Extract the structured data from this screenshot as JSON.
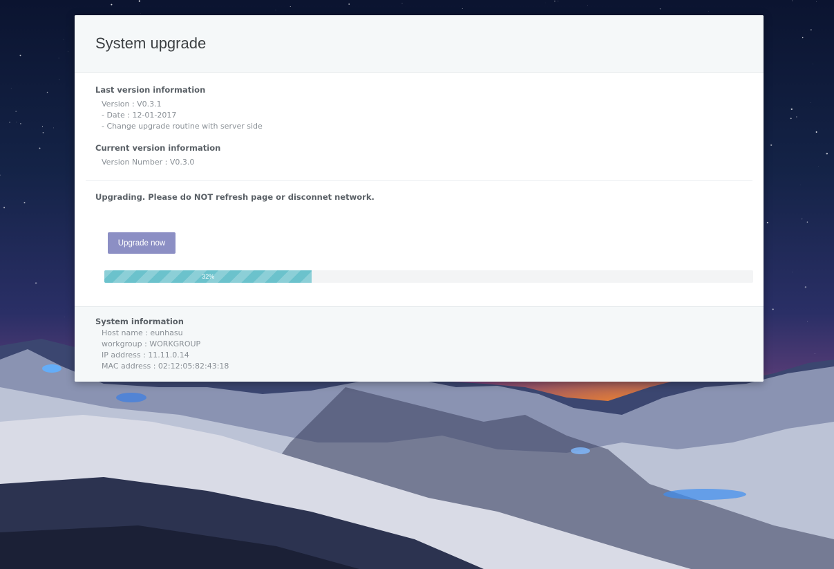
{
  "title": "System upgrade",
  "last_version": {
    "heading": "Last version information",
    "lines": [
      "Version : V0.3.1",
      "- Date : 12-01-2017",
      "- Change upgrade routine with server side"
    ]
  },
  "current_version": {
    "heading": "Current version information",
    "line": "Version Number : V0.3.0"
  },
  "warning": "Upgrading. Please do NOT refresh page or disconnet network.",
  "upgrade_button": "Upgrade now",
  "progress": {
    "percent": 32,
    "label": "32%"
  },
  "system_info": {
    "heading": "System information",
    "lines": [
      "Host name : eunhasu",
      "workgroup : WORKGROUP",
      "IP address : 11.11.0.14",
      "MAC address : 02:12:05:82:43:18"
    ]
  },
  "colors": {
    "button": "#8c8fc4",
    "progress_fill": "#6bc2cc",
    "header_bg": "#f5f8f9"
  }
}
